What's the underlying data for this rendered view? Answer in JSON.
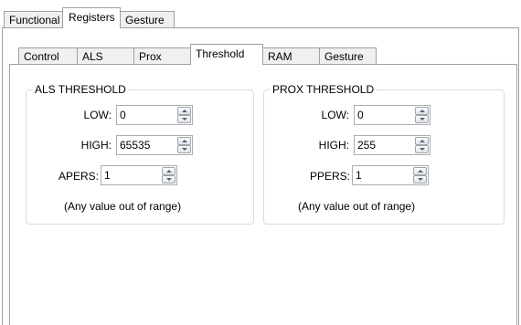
{
  "main_tabs": [
    {
      "label": "Functional"
    },
    {
      "label": "Registers"
    },
    {
      "label": "Gesture"
    }
  ],
  "sub_tabs": [
    {
      "label": "Control"
    },
    {
      "label": "ALS"
    },
    {
      "label": "Prox"
    },
    {
      "label": "Threshold"
    },
    {
      "label": "RAM"
    },
    {
      "label": "Gesture"
    }
  ],
  "als": {
    "title": "ALS THRESHOLD",
    "low_label": "LOW:",
    "low_value": "0",
    "high_label": "HIGH:",
    "high_value": "65535",
    "pers_label": "APERS:",
    "pers_value": "1",
    "note": "(Any value out of range)"
  },
  "prox": {
    "title": "PROX THRESHOLD",
    "low_label": "LOW:",
    "low_value": "0",
    "high_label": "HIGH:",
    "high_value": "255",
    "pers_label": "PPERS:",
    "pers_value": "1",
    "note": "(Any value out of range)"
  }
}
